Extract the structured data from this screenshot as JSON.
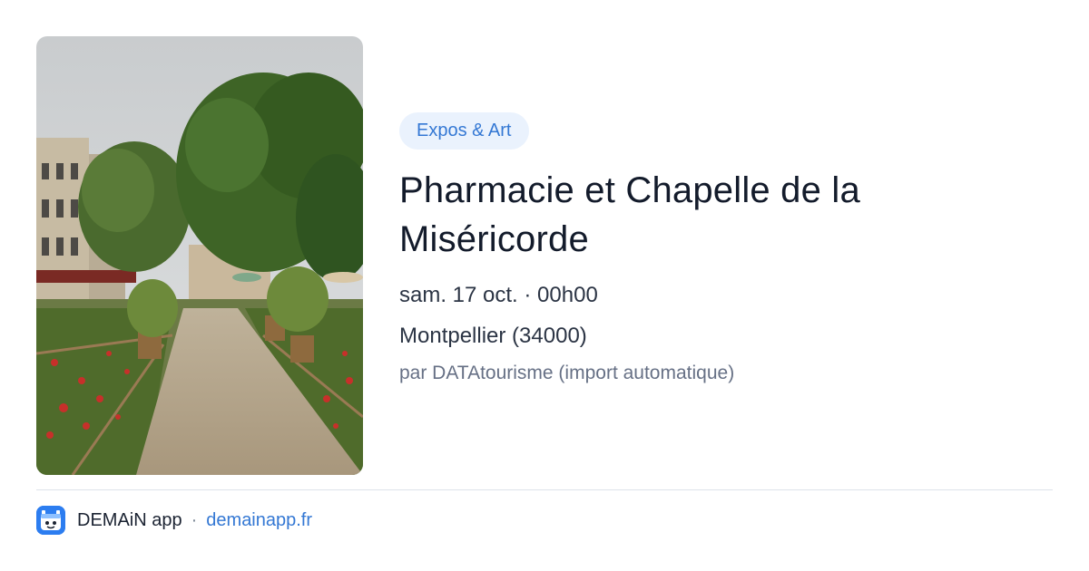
{
  "event": {
    "category": "Expos & Art",
    "title_line1": "Pharmacie et Chapelle de la",
    "title_line2": "Miséricorde",
    "date": "sam. 17 oct. · 00h00",
    "location": "Montpellier (34000)",
    "source": "par DATAtourisme (import automatique)"
  },
  "footer": {
    "app_name": "DEMAiN app",
    "separator": "·",
    "link": "demainapp.fr",
    "icon": "demain-app-icon"
  },
  "colors": {
    "accent": "#3478d4",
    "tag_bg": "#eaf2fd",
    "app_icon": "#2c7df0"
  }
}
